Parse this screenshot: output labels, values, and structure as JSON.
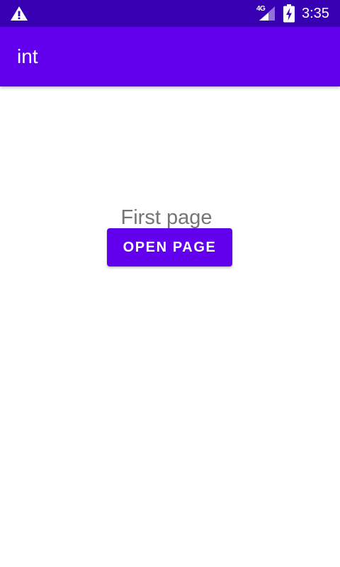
{
  "status_bar": {
    "network": "4G",
    "time": "3:35",
    "icons": [
      "warning-icon",
      "signal-icon",
      "battery-charging-icon"
    ]
  },
  "app_bar": {
    "title": "int"
  },
  "main": {
    "text": "First page",
    "button_label": "OPEN PAGE"
  },
  "colors": {
    "status_bar": "#3700b3",
    "primary": "#6200ee",
    "text_secondary": "#757575",
    "background": "#ffffff"
  }
}
